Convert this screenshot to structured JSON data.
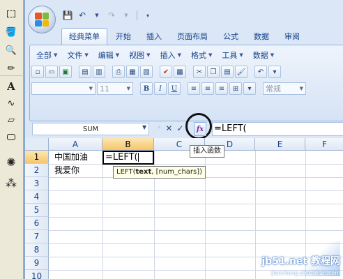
{
  "toolbox": {
    "tools": [
      "select-rect-icon",
      "fill-icon",
      "magnifier-icon",
      "pencil-icon",
      "text-icon",
      "curve-icon",
      "polygon-icon",
      "rounded-rect-icon",
      "airbrush-icon",
      "spray-icon"
    ],
    "text_tool": "A"
  },
  "qat": {
    "save": "💾",
    "undo": "↶",
    "redo": "↷"
  },
  "tabs": [
    "经典菜单",
    "开始",
    "插入",
    "页面布局",
    "公式",
    "数据",
    "审阅"
  ],
  "active_tab": 0,
  "ribbon": {
    "menu": [
      "全部",
      "文件",
      "编辑",
      "视图",
      "插入",
      "格式",
      "工具",
      "数据"
    ],
    "font_size": "11",
    "number_format": "常规"
  },
  "formula_bar": {
    "name_box": "SUM",
    "cancel": "✕",
    "enter": "✓",
    "fx": "fx",
    "value": "=LEFT("
  },
  "tooltip_fx": "插入函数",
  "grid": {
    "columns": [
      "A",
      "B",
      "C",
      "D",
      "E",
      "F"
    ],
    "selected_column": "B",
    "rows": [
      "1",
      "2",
      "3",
      "4",
      "5",
      "6",
      "7",
      "8",
      "9",
      "10"
    ],
    "selected_row": "1",
    "cells": {
      "A1": "中国加油",
      "A2": "我爱你"
    },
    "active_cell_value": "=LEFT("
  },
  "hint": {
    "func": "LEFT(",
    "arg1": "text",
    "rest": ", [num_chars])"
  },
  "watermark": {
    "main": "jb51.net 教程网",
    "sub": "jiaocheng.chazidian.com"
  }
}
